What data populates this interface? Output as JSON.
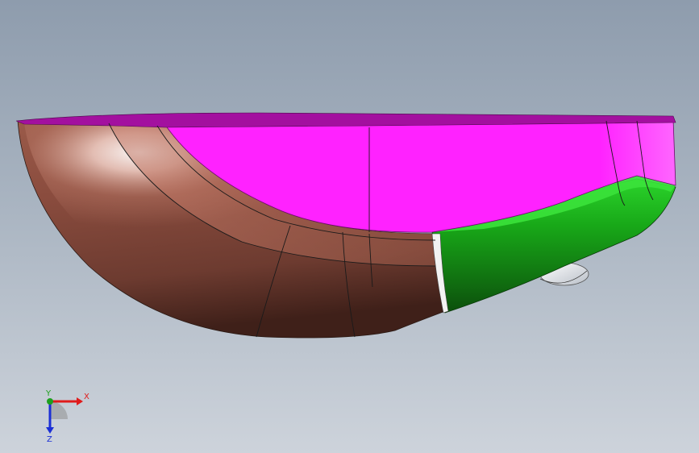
{
  "viewport": {
    "background_top": "#8e9cad",
    "background_bottom": "#cdd3db"
  },
  "model": {
    "colors": {
      "top_face": "#ff1aff",
      "rim": "#a3109f",
      "shell_copper": "#b46a58",
      "shell_dark": "#5a2f25",
      "green_section": "#1fc01f",
      "green_dark": "#0f5a0f",
      "silver_part": "#e6e9ee"
    }
  },
  "triad": {
    "x_label": "X",
    "y_label": "Y",
    "z_label": "Z",
    "x_color": "#e01b1b",
    "y_color": "#1ea01e",
    "z_color": "#1b2fd6"
  }
}
